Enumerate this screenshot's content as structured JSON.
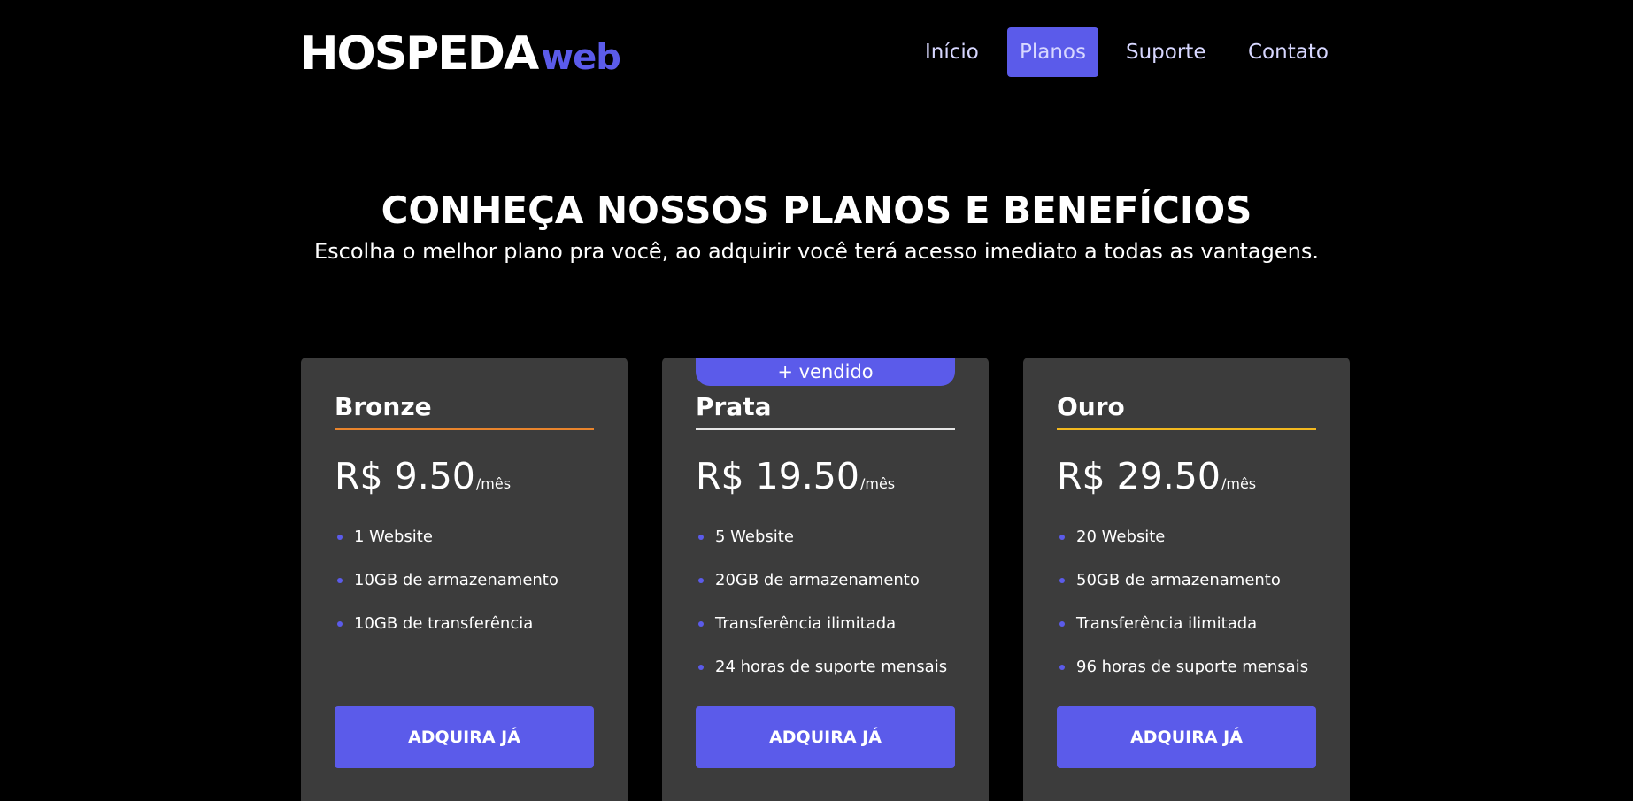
{
  "header": {
    "logo_main": "HOSPEDA",
    "logo_accent": "web",
    "nav": [
      {
        "label": "Início",
        "active": false
      },
      {
        "label": "Planos",
        "active": true
      },
      {
        "label": "Suporte",
        "active": false
      },
      {
        "label": "Contato",
        "active": false
      }
    ]
  },
  "hero": {
    "title": "CONHEÇA NOSSOS PLANOS E BENEFÍCIOS",
    "subtitle": "Escolha o melhor plano pra você, ao adquirir você terá acesso imediato a todas as vantagens."
  },
  "plans": [
    {
      "name": "Bronze",
      "badge": "",
      "accent_color": "#e8842c",
      "price": "R$ 9.50",
      "period": "/mês",
      "features": [
        "1 Website",
        "10GB de armazenamento",
        "10GB de transferência"
      ],
      "button": "ADQUIRA JÁ"
    },
    {
      "name": "Prata",
      "badge": "+ vendido",
      "accent_color": "#e6e6e6",
      "price": "R$ 19.50",
      "period": "/mês",
      "features": [
        "5 Website",
        "20GB de armazenamento",
        "Transferência ilimitada",
        "24 horas de suporte mensais"
      ],
      "button": "ADQUIRA JÁ"
    },
    {
      "name": "Ouro",
      "badge": "",
      "accent_color": "#f2b81f",
      "price": "R$ 29.50",
      "period": "/mês",
      "features": [
        "20 Website",
        "50GB de armazenamento",
        "Transferência ilimitada",
        "96 horas de suporte mensais"
      ],
      "button": "ADQUIRA JÁ"
    }
  ],
  "colors": {
    "background": "#000000",
    "card": "#3c3c3c",
    "brand": "#5b5bea",
    "text": "#ffffff"
  }
}
